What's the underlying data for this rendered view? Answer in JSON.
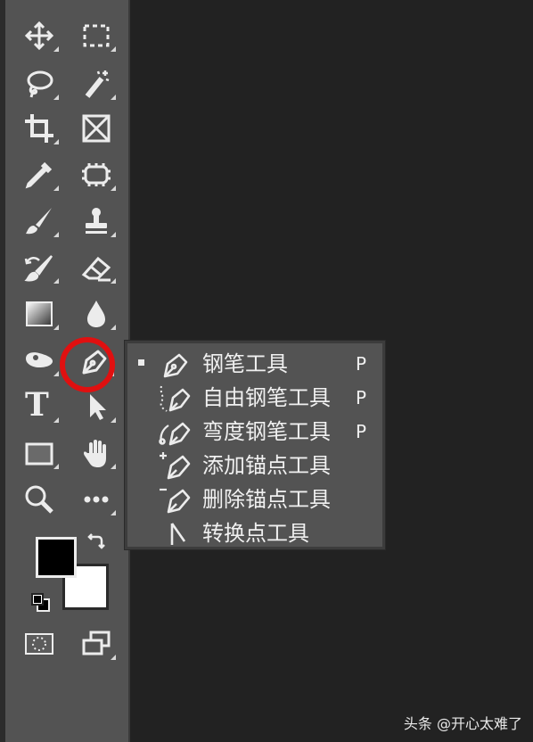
{
  "toolbar": {
    "type_tool_glyph": "T",
    "tools": [
      {
        "name": "move-tool",
        "icon": "move-icon"
      },
      {
        "name": "rectangular-marquee-tool",
        "icon": "marquee-icon"
      },
      {
        "name": "lasso-tool",
        "icon": "lasso-icon"
      },
      {
        "name": "magic-wand-tool",
        "icon": "magic-wand-icon"
      },
      {
        "name": "crop-tool",
        "icon": "crop-icon"
      },
      {
        "name": "frame-tool",
        "icon": "frame-icon"
      },
      {
        "name": "eyedropper-tool",
        "icon": "eyedropper-icon"
      },
      {
        "name": "spot-healing-tool",
        "icon": "healing-icon"
      },
      {
        "name": "brush-tool",
        "icon": "brush-icon"
      },
      {
        "name": "clone-stamp-tool",
        "icon": "stamp-icon"
      },
      {
        "name": "history-brush-tool",
        "icon": "history-brush-icon"
      },
      {
        "name": "eraser-tool",
        "icon": "eraser-icon"
      },
      {
        "name": "gradient-tool",
        "icon": "gradient-icon"
      },
      {
        "name": "blur-tool",
        "icon": "blur-drop-icon"
      },
      {
        "name": "dodge-tool",
        "icon": "dodge-icon"
      },
      {
        "name": "pen-tool",
        "icon": "pen-icon"
      },
      {
        "name": "type-tool",
        "icon": "type-icon"
      },
      {
        "name": "path-selection-tool",
        "icon": "arrow-icon"
      },
      {
        "name": "rectangle-tool",
        "icon": "rectangle-icon"
      },
      {
        "name": "hand-tool",
        "icon": "hand-icon"
      },
      {
        "name": "zoom-tool",
        "icon": "zoom-icon"
      },
      {
        "name": "more-tools",
        "icon": "ellipsis-icon"
      }
    ],
    "foreground_color": "#000000",
    "background_color": "#ffffff"
  },
  "highlight": {
    "color": "#e01010",
    "target": "pen-tool"
  },
  "flyout": {
    "items": [
      {
        "label": "钢笔工具",
        "shortcut": "P",
        "icon": "pen-icon",
        "selected": true
      },
      {
        "label": "自由钢笔工具",
        "shortcut": "P",
        "icon": "freeform-pen-icon",
        "selected": false
      },
      {
        "label": "弯度钢笔工具",
        "shortcut": "P",
        "icon": "curvature-pen-icon",
        "selected": false
      },
      {
        "label": "添加锚点工具",
        "shortcut": "",
        "icon": "add-anchor-icon",
        "selected": false
      },
      {
        "label": "删除锚点工具",
        "shortcut": "",
        "icon": "delete-anchor-icon",
        "selected": false
      },
      {
        "label": "转换点工具",
        "shortcut": "",
        "icon": "convert-point-icon",
        "selected": false
      }
    ]
  },
  "watermark": "头条 @开心太难了"
}
